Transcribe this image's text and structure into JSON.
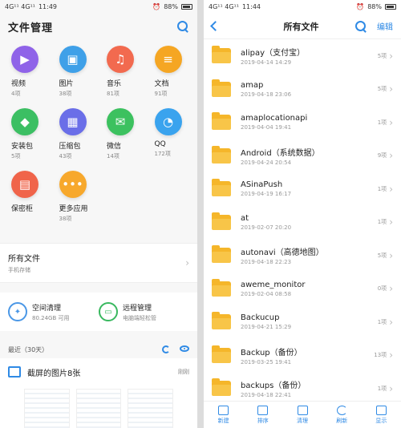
{
  "left": {
    "status": {
      "time": "11:49",
      "signal": "4G¹¹ 4G¹¹",
      "battery": "88%"
    },
    "title": "文件管理",
    "categories": [
      {
        "name": "视频",
        "count": "4项",
        "color": "#8f63e8",
        "glyph": "▶"
      },
      {
        "name": "图片",
        "count": "38项",
        "color": "#3fa0e8",
        "glyph": "▣"
      },
      {
        "name": "音乐",
        "count": "81项",
        "color": "#f26a4f",
        "glyph": "♫"
      },
      {
        "name": "文档",
        "count": "91项",
        "color": "#f5a623",
        "glyph": "≡"
      },
      {
        "name": "安装包",
        "count": "5项",
        "color": "#3cbf63",
        "glyph": "◆"
      },
      {
        "name": "压缩包",
        "count": "43项",
        "color": "#6a6ee8",
        "glyph": "▦"
      },
      {
        "name": "微信",
        "count": "14项",
        "color": "#3cc15f",
        "glyph": "✉"
      },
      {
        "name": "QQ",
        "count": "172项",
        "color": "#3aa3ee",
        "glyph": "◔"
      },
      {
        "name": "保密柜",
        "count": "",
        "color": "#f0644a",
        "glyph": "▤"
      },
      {
        "name": "更多应用",
        "count": "38项",
        "color": "#f7a82c",
        "glyph": "•••"
      }
    ],
    "all_files": {
      "title": "所有文件",
      "subtitle": "手机存储"
    },
    "tools": [
      {
        "title": "空间清理",
        "sub": "80.24GB 可用"
      },
      {
        "title": "远程管理",
        "sub": "电脑端轻松管"
      }
    ],
    "recent": {
      "label": "最近（30天）"
    },
    "screenshot": {
      "title": "截屏的图片8张",
      "time": "刚刚"
    }
  },
  "right": {
    "status": {
      "time": "11:44",
      "signal": "4G¹¹ 4G¹¹",
      "battery": "88%"
    },
    "title": "所有文件",
    "edit": "编辑",
    "folders": [
      {
        "name": "alipay（支付宝）",
        "date": "2019-04-14 14:29",
        "count": "5项"
      },
      {
        "name": "amap",
        "date": "2019-04-18 23:06",
        "count": "5项"
      },
      {
        "name": "amaplocationapi",
        "date": "2019-04-04 19:41",
        "count": "1项"
      },
      {
        "name": "Android（系统数据）",
        "date": "2019-04-24 20:54",
        "count": "9项"
      },
      {
        "name": "ASinaPush",
        "date": "2019-04-19 16:17",
        "count": "1项"
      },
      {
        "name": "at",
        "date": "2019-02-07 20:20",
        "count": "1项"
      },
      {
        "name": "autonavi（高德地图）",
        "date": "2019-04-18 22:23",
        "count": "5项"
      },
      {
        "name": "aweme_monitor",
        "date": "2019-02-04 08:58",
        "count": "0项"
      },
      {
        "name": "Backucup",
        "date": "2019-04-21 15:29",
        "count": "1项"
      },
      {
        "name": "Backup（备份）",
        "date": "2019-03-25 19:41",
        "count": "13项"
      },
      {
        "name": "backups（备份）",
        "date": "2019-04-18 22:41",
        "count": "1项"
      }
    ],
    "bottom": [
      "新建",
      "排序",
      "清理",
      "刷新",
      "显示"
    ]
  }
}
